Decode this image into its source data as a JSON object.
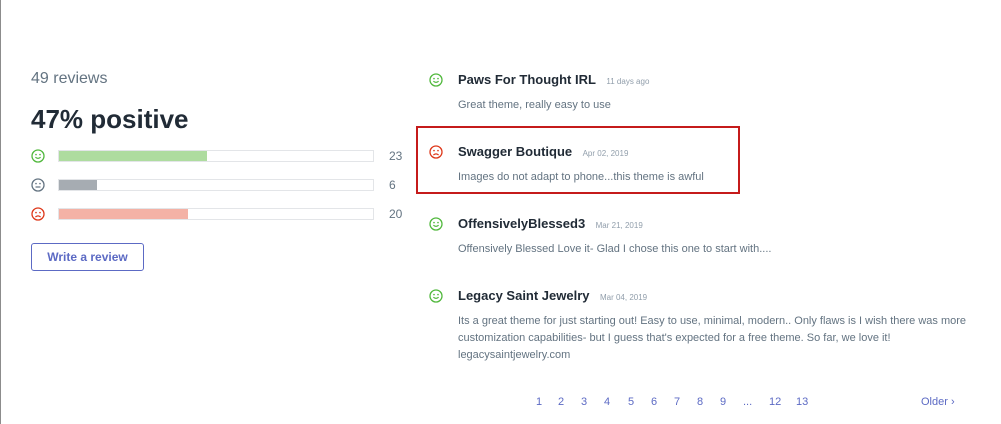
{
  "summary": {
    "review_count": "49 reviews",
    "positive_label": "47% positive",
    "bars": [
      {
        "sentiment": "positive",
        "count": "23",
        "fill_fraction": 0.47,
        "color": "#aedc9f",
        "face_color": "#50b83c"
      },
      {
        "sentiment": "neutral",
        "count": "6",
        "fill_fraction": 0.12,
        "color": "#a6acb2",
        "face_color": "#637381"
      },
      {
        "sentiment": "negative",
        "count": "20",
        "fill_fraction": 0.41,
        "color": "#f4b2a6",
        "face_color": "#de3618"
      }
    ],
    "write_review_label": "Write a review"
  },
  "reviews": [
    {
      "author": "Paws For Thought IRL",
      "date": "11 days ago",
      "body": "Great theme, really easy to use",
      "sentiment": "positive"
    },
    {
      "author": "Swagger Boutique",
      "date": "Apr 02, 2019",
      "body": "Images do not adapt to phone...this theme is awful",
      "sentiment": "negative"
    },
    {
      "author": "OffensivelyBlessed3",
      "date": "Mar 21, 2019",
      "body": "Offensively Blessed Love it- Glad I chose this one to start with....",
      "sentiment": "positive"
    },
    {
      "author": "Legacy Saint Jewelry",
      "date": "Mar 04, 2019",
      "body": "Its a great theme for just starting out! Easy to use, minimal, modern.. Only flaws is I wish there was more customization capabilities- but I guess that's expected for a free theme. So far, we love it! legacysaintjewelry.com",
      "sentiment": "positive"
    }
  ],
  "pagination": {
    "pages": [
      "1",
      "2",
      "3",
      "4",
      "5",
      "6",
      "7",
      "8",
      "9"
    ],
    "ellipsis": "...",
    "last_pages": [
      "12",
      "13"
    ],
    "older_label": "Older ›"
  },
  "colors": {
    "accent": "#5c6ac4",
    "highlight": "#c51b1b"
  }
}
